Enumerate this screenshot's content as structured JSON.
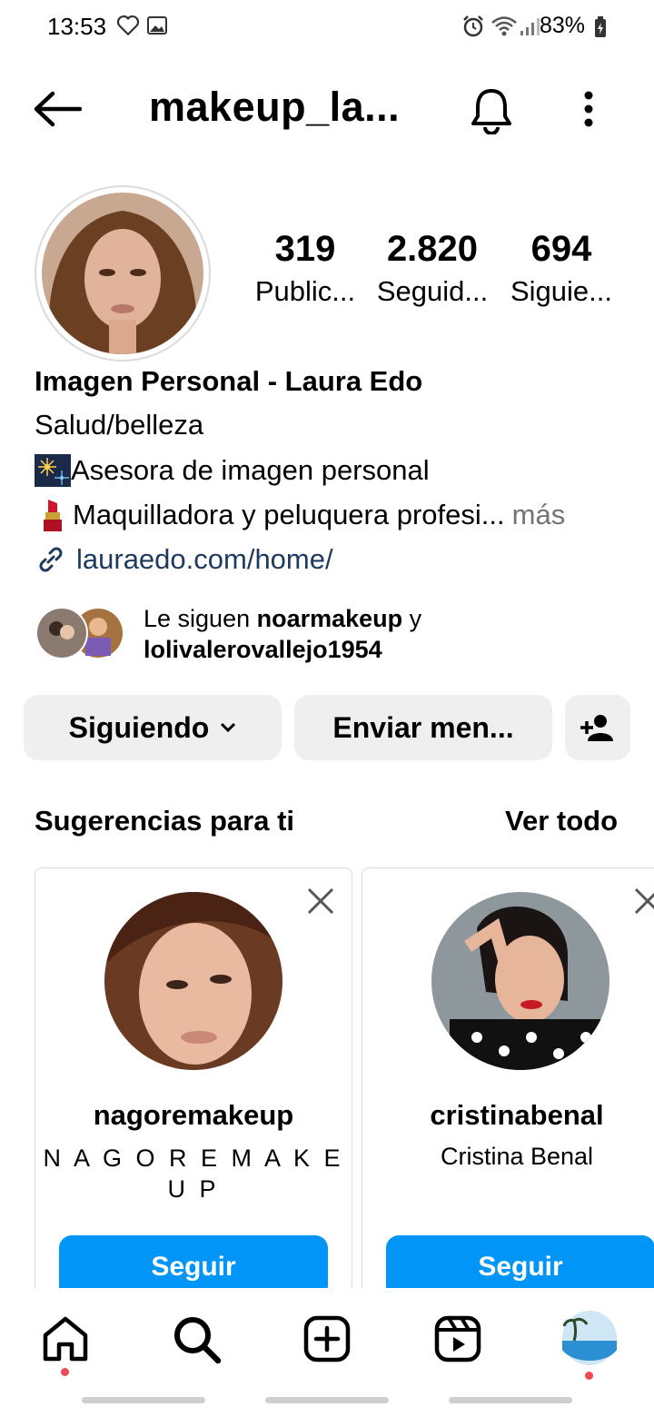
{
  "status_bar": {
    "time": "13:53",
    "battery": "83%"
  },
  "header": {
    "title": "makeup_la..."
  },
  "profile": {
    "stats": [
      {
        "value": "319",
        "label": "Public..."
      },
      {
        "value": "2.820",
        "label": "Seguid..."
      },
      {
        "value": "694",
        "label": "Siguie..."
      }
    ],
    "name": "Imagen Personal - Laura Edo",
    "category": "Salud/belleza",
    "bio_line1": "Asesora de imagen personal",
    "bio_line2": "Maquilladora y peluquera profesi...",
    "more": "más",
    "link": "lauraedo.com/home/",
    "followed_by_prefix": "Le siguen ",
    "followed_by_user1": "noarmakeup",
    "followed_by_and": " y",
    "followed_by_user2": "lolivalerovallejo1954"
  },
  "actions": {
    "following_label": "Siguiendo",
    "message_label": "Enviar men..."
  },
  "suggestions": {
    "heading": "Sugerencias para ti",
    "see_all": "Ver todo",
    "cards": [
      {
        "username": "nagoremakeup",
        "full_name": "N A G O R E   M A K E\nU P",
        "follow_label": "Seguir"
      },
      {
        "username": "cristinabenal",
        "full_name": "Cristina Benal",
        "follow_label": "Seguir"
      }
    ]
  },
  "colors": {
    "accent": "#0095f6",
    "notification_dot": "#ed4956"
  }
}
